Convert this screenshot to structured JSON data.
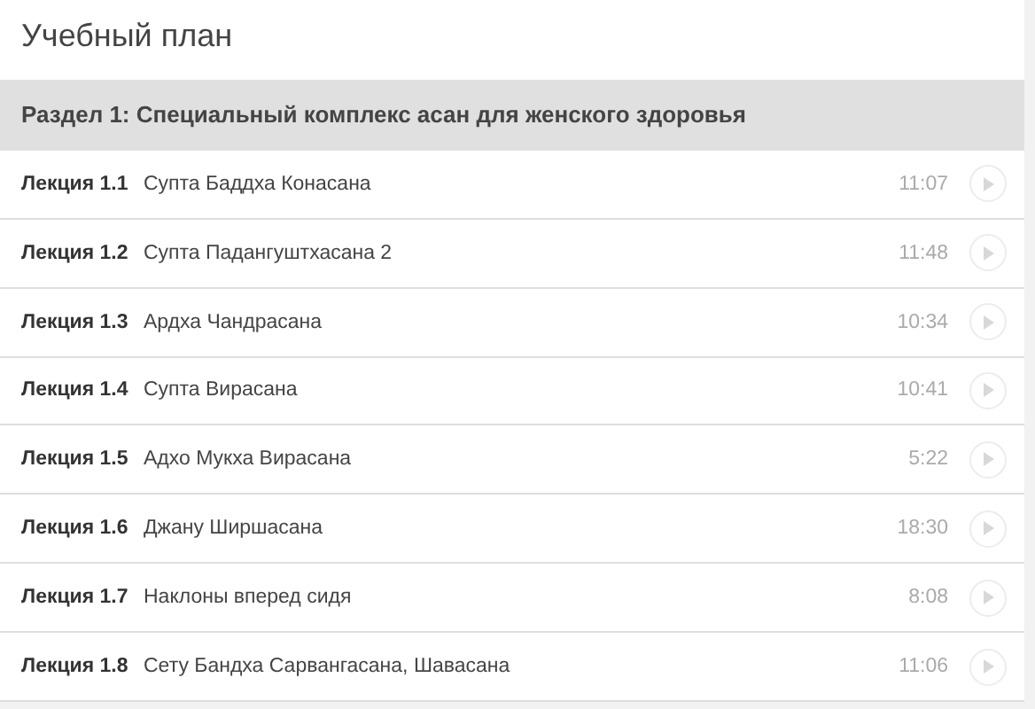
{
  "title": "Учебный план",
  "section": {
    "title": "Раздел 1: Специальный комплекс асан для женского здоровья"
  },
  "lectures": [
    {
      "number": "Лекция 1.1",
      "name": "Супта Баддха Конасана",
      "duration": "11:07"
    },
    {
      "number": "Лекция 1.2",
      "name": "Супта Падангуштхасана 2",
      "duration": "11:48"
    },
    {
      "number": "Лекция 1.3",
      "name": "Ардха Чандрасана",
      "duration": "10:34"
    },
    {
      "number": "Лекция 1.4",
      "name": "Супта Вирасана",
      "duration": "10:41"
    },
    {
      "number": "Лекция 1.5",
      "name": "Адхо Мукха Вирасана",
      "duration": "5:22"
    },
    {
      "number": "Лекция 1.6",
      "name": "Джану Ширшасана",
      "duration": "18:30"
    },
    {
      "number": "Лекция 1.7",
      "name": "Наклоны вперед сидя",
      "duration": "8:08"
    },
    {
      "number": "Лекция 1.8",
      "name": "Сету Бандха Сарвангасана, Шавасана",
      "duration": "11:06"
    }
  ]
}
